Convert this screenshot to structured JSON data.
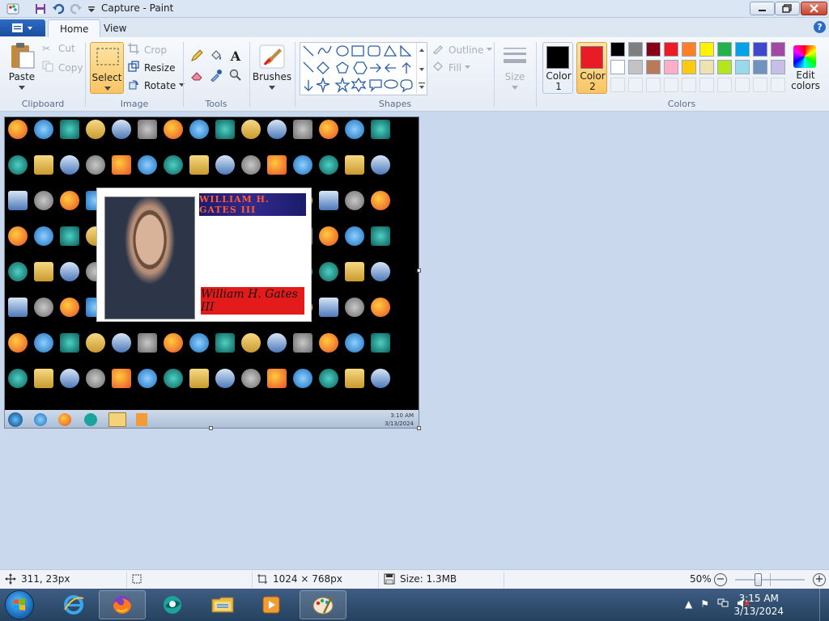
{
  "window": {
    "title": "Capture - Paint"
  },
  "tabs": [
    {
      "label": "Home",
      "active": true
    },
    {
      "label": "View",
      "active": false
    }
  ],
  "ribbon": {
    "clipboard": {
      "label": "Clipboard",
      "paste": "Paste",
      "cut": "Cut",
      "copy": "Copy"
    },
    "image": {
      "label": "Image",
      "select": "Select",
      "crop": "Crop",
      "resize": "Resize",
      "rotate": "Rotate"
    },
    "tools": {
      "label": "Tools"
    },
    "brushes": {
      "label": "Brushes"
    },
    "shapes": {
      "label": "Shapes",
      "outline": "Outline",
      "fill": "Fill"
    },
    "size": {
      "label": "Size"
    },
    "colors": {
      "label": "Colors",
      "color1_line1": "Color",
      "color1_line2": "1",
      "color2_line1": "Color",
      "color2_line2": "2",
      "edit_line1": "Edit",
      "edit_line2": "colors",
      "color1_value": "#000000",
      "color2_value": "#e81c24",
      "palette_row1": [
        "#000000",
        "#7f7f7f",
        "#880015",
        "#ed1c24",
        "#ff7f27",
        "#fff200",
        "#22b14c",
        "#00a2e8",
        "#3f48cc",
        "#a349a4"
      ],
      "palette_row2": [
        "#ffffff",
        "#c3c3c3",
        "#b97a57",
        "#ffaec9",
        "#ffc90e",
        "#efe4b0",
        "#b5e61d",
        "#99d9ea",
        "#7092be",
        "#c8bfe7"
      ],
      "palette_row3": [
        "#ffffff",
        "#ffffff",
        "#ffffff",
        "#ffffff",
        "#ffffff",
        "#ffffff",
        "#ffffff",
        "#ffffff",
        "#ffffff",
        "#ffffff"
      ]
    }
  },
  "canvas": {
    "id_card": {
      "name_banner": "WILLIAM H. GATES III",
      "signature": "William H. Gates III"
    },
    "mini_taskbar": {
      "time": "3:10 AM",
      "date": "3/13/2024"
    }
  },
  "status": {
    "cursor_pos": "311, 23px",
    "canvas_size": "1024 × 768px",
    "file_size": "Size: 1.3MB",
    "zoom": "50%",
    "zoom_fraction": 0.5
  },
  "taskbar": {
    "time": "3:15 AM",
    "date": "3/13/2024"
  }
}
